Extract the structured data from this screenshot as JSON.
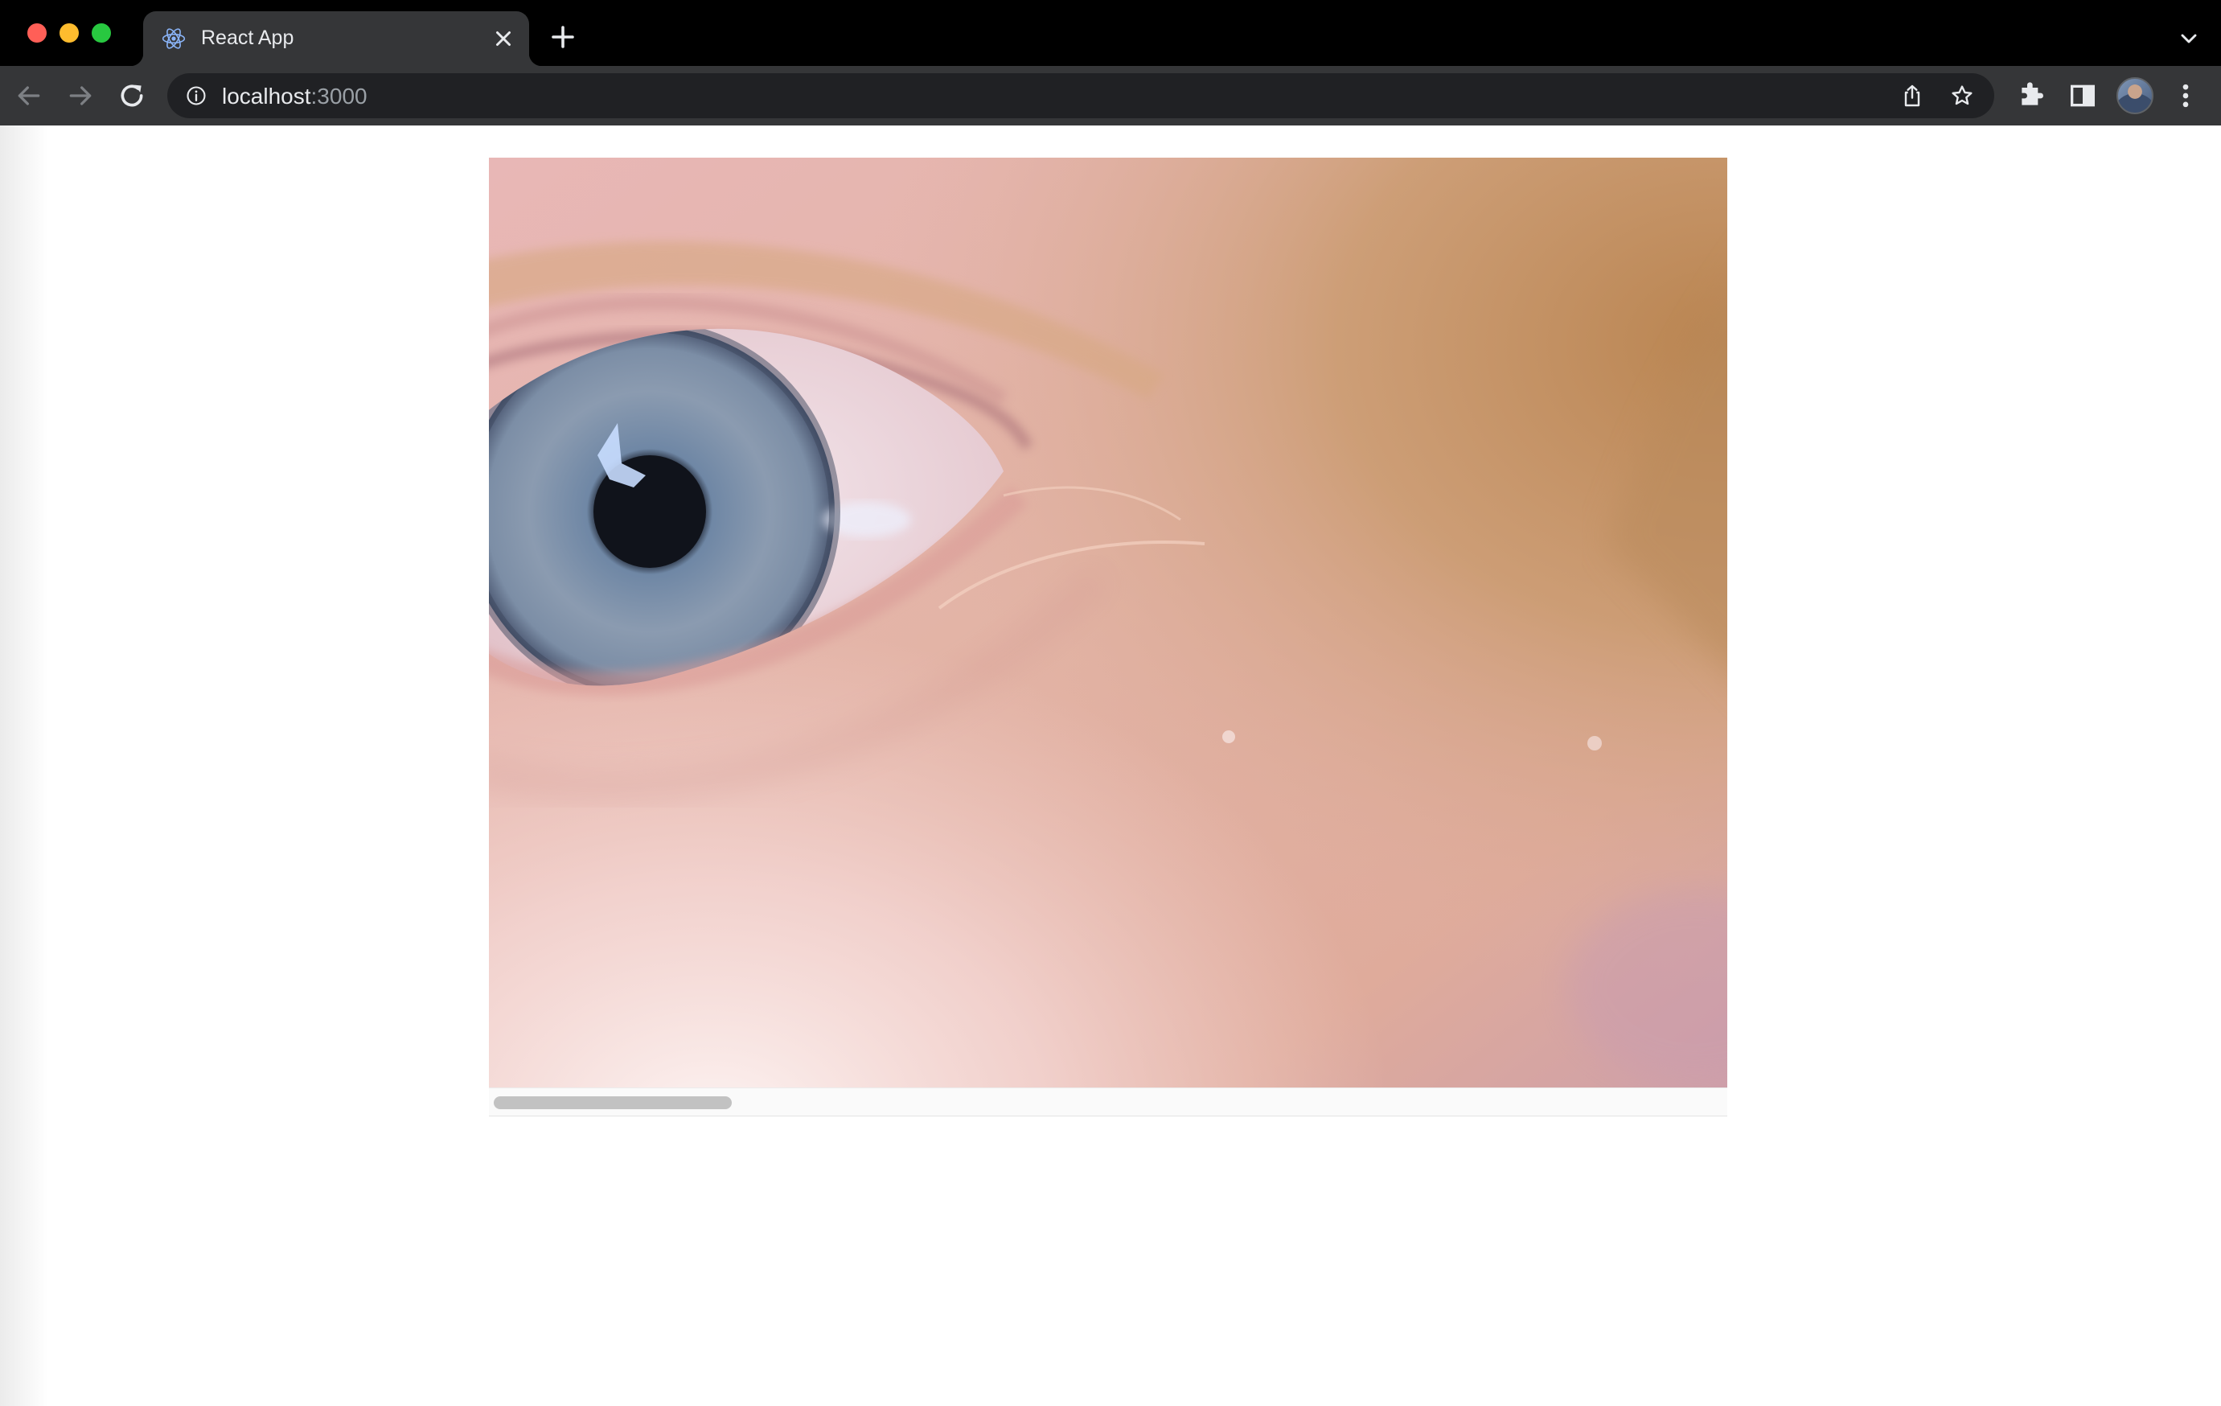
{
  "browser": {
    "tab": {
      "title": "React App",
      "favicon": "react-logo-icon"
    },
    "address_bar": {
      "host": "localhost",
      "port": ":3000"
    },
    "colors": {
      "close": "#ff5f57",
      "minimize": "#febc2e",
      "maximize": "#28c840",
      "toolbar": "#353638",
      "omnibox": "#202124"
    },
    "icons": [
      "back-arrow-icon",
      "forward-arrow-icon",
      "reload-icon",
      "info-icon",
      "share-icon",
      "star-icon",
      "extensions-icon",
      "side-panel-icon",
      "profile-avatar",
      "more-menu-icon",
      "new-tab-icon",
      "tab-search-icon"
    ]
  },
  "page": {
    "image": {
      "subject": "close-up photo of a blue-grey eye",
      "scroll_position": 0
    }
  }
}
